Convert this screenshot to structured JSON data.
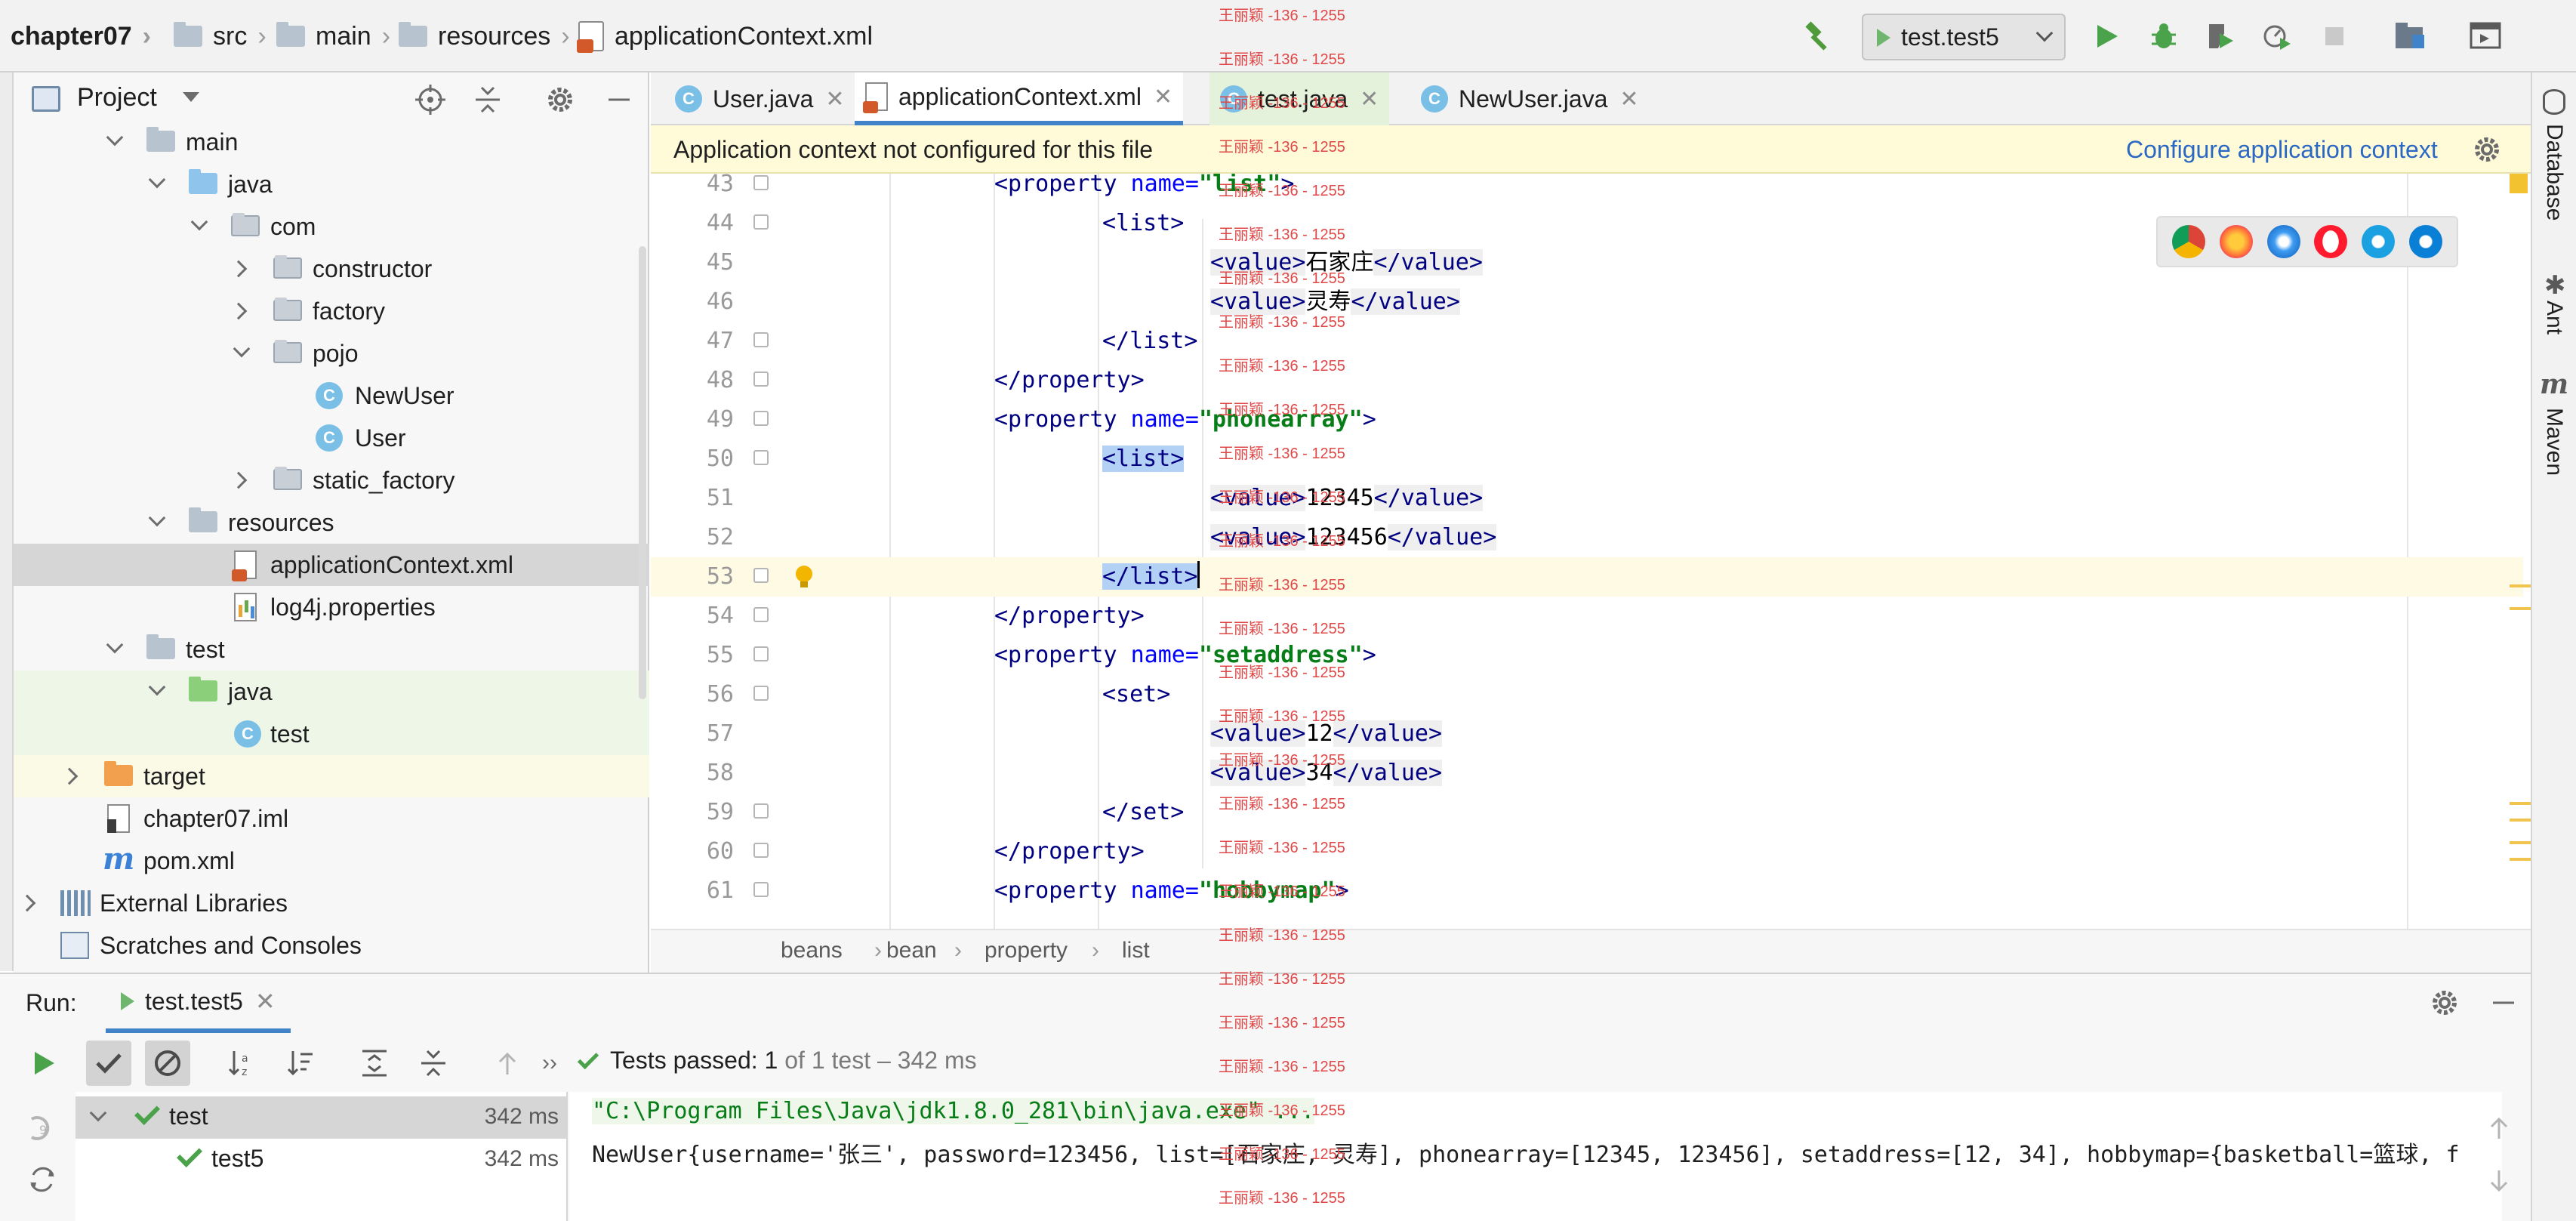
{
  "navbar": {
    "breadcrumbs": [
      "chapter07",
      "src",
      "main",
      "resources",
      "applicationContext.xml"
    ],
    "run_config": "test.test5"
  },
  "project_panel": {
    "title": "Project",
    "tree": [
      {
        "label": "main",
        "icon": "folder-icon",
        "expanded": true
      },
      {
        "label": "java",
        "icon": "source-folder-icon",
        "expanded": true
      },
      {
        "label": "com",
        "icon": "package-icon",
        "expanded": true
      },
      {
        "label": "constructor",
        "icon": "package-icon",
        "expanded": false
      },
      {
        "label": "factory",
        "icon": "package-icon",
        "expanded": false
      },
      {
        "label": "pojo",
        "icon": "package-icon",
        "expanded": true
      },
      {
        "label": "NewUser",
        "icon": "class-icon"
      },
      {
        "label": "User",
        "icon": "class-icon"
      },
      {
        "label": "static_factory",
        "icon": "package-icon",
        "expanded": false
      },
      {
        "label": "resources",
        "icon": "resources-folder-icon",
        "expanded": true
      },
      {
        "label": "applicationContext.xml",
        "icon": "xml-file-icon",
        "selected": true
      },
      {
        "label": "log4j.properties",
        "icon": "properties-file-icon"
      },
      {
        "label": "test",
        "icon": "folder-icon",
        "expanded": true
      },
      {
        "label": "java",
        "icon": "test-source-folder-icon",
        "expanded": true
      },
      {
        "label": "test",
        "icon": "test-class-icon"
      },
      {
        "label": "target",
        "icon": "excluded-folder-icon",
        "expanded": false
      },
      {
        "label": "chapter07.iml",
        "icon": "iml-file-icon"
      },
      {
        "label": "pom.xml",
        "icon": "maven-icon"
      },
      {
        "label": "External Libraries",
        "icon": "libraries-icon",
        "expanded": false
      },
      {
        "label": "Scratches and Consoles",
        "icon": "scratches-icon"
      }
    ]
  },
  "editor": {
    "tabs": [
      {
        "label": "User.java",
        "icon": "class-icon"
      },
      {
        "label": "applicationContext.xml",
        "icon": "xml-file-icon",
        "active": true
      },
      {
        "label": "test.java",
        "icon": "class-icon"
      },
      {
        "label": "NewUser.java",
        "icon": "class-icon"
      }
    ],
    "banner": {
      "message": "Application context not configured for this file",
      "action": "Configure application context"
    },
    "lines": [
      {
        "n": "43",
        "indent": 2,
        "tag": "<property",
        "attr": " name=",
        "val": "\"list\"",
        "close": ">"
      },
      {
        "n": "44",
        "indent": 3,
        "tag": "<list>"
      },
      {
        "n": "45",
        "indent": 4,
        "tag": "<value>",
        "text": "石家庄",
        "close": "</value>"
      },
      {
        "n": "46",
        "indent": 4,
        "tag": "<value>",
        "text": "灵寿",
        "close": "</value>"
      },
      {
        "n": "47",
        "indent": 3,
        "tag": "</list>"
      },
      {
        "n": "48",
        "indent": 2,
        "tag": "</property>"
      },
      {
        "n": "49",
        "indent": 2,
        "tag": "<property",
        "attr": " name=",
        "val": "\"phonearray\"",
        "close": ">"
      },
      {
        "n": "50",
        "indent": 3,
        "tag": "<list>"
      },
      {
        "n": "51",
        "indent": 4,
        "tag": "<value>",
        "text": "12345",
        "close": "</value>"
      },
      {
        "n": "52",
        "indent": 4,
        "tag": "<value>",
        "text": "123456",
        "close": "</value>"
      },
      {
        "n": "53",
        "indent": 3,
        "tag": "</list>"
      },
      {
        "n": "54",
        "indent": 2,
        "tag": "</property>"
      },
      {
        "n": "55",
        "indent": 2,
        "tag": "<property",
        "attr": " name=",
        "val": "\"setaddress\"",
        "close": ">"
      },
      {
        "n": "56",
        "indent": 3,
        "tag": "<set>"
      },
      {
        "n": "57",
        "indent": 4,
        "tag": "<value>",
        "text": "12",
        "close": "</value>"
      },
      {
        "n": "58",
        "indent": 4,
        "tag": "<value>",
        "text": "34",
        "close": "</value>"
      },
      {
        "n": "59",
        "indent": 3,
        "tag": "</set>"
      },
      {
        "n": "60",
        "indent": 2,
        "tag": "</property>"
      },
      {
        "n": "61",
        "indent": 2,
        "tag": "<property",
        "attr": " name=",
        "val": "\"hobbymap\"",
        "close": ">"
      }
    ],
    "breadcrumbs": [
      "beans",
      "bean",
      "property",
      "list"
    ]
  },
  "watermark": "王丽颖 -136 - 1255",
  "right_strip": [
    "Database",
    "Ant",
    "Maven"
  ],
  "run_panel": {
    "label": "Run:",
    "tab": "test.test5",
    "status_bold": "Tests passed: 1",
    "status_rest": " of 1 test – 342 ms",
    "tests": [
      {
        "name": "test",
        "time": "342 ms"
      },
      {
        "name": "test5",
        "time": "342 ms"
      }
    ],
    "console": [
      "\"C:\\Program Files\\Java\\jdk1.8.0_281\\bin\\java.exe\" ...",
      "NewUser{username='张三', password=123456, list=[石家庄, 灵寿], phonearray=[12345, 123456], setaddress=[12, 34], hobbymap={basketball=篮球, f"
    ]
  }
}
